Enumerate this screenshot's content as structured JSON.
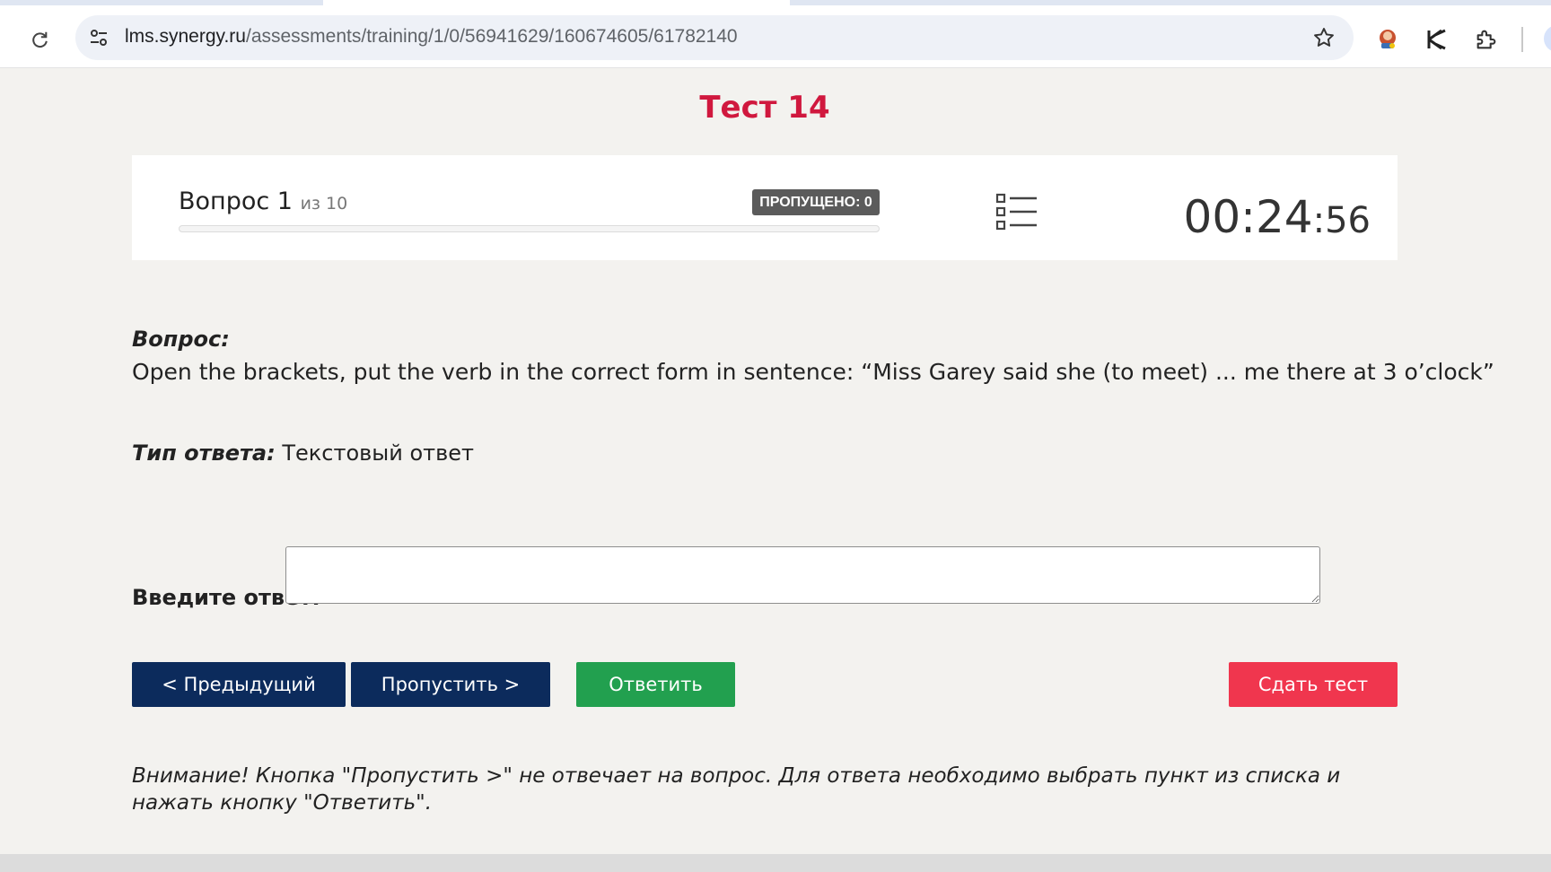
{
  "browser": {
    "url_host": "lms.synergy.ru",
    "url_path": "/assessments/training/1/0/56941629/160674605/61782140",
    "icons": [
      "reload-icon",
      "site-info-icon",
      "bookmark-star-icon",
      "extension-avatar-icon",
      "extension-k-icon",
      "extensions-puzzle-icon"
    ]
  },
  "page": {
    "title": "Тест 14"
  },
  "progress_panel": {
    "question_word": "Вопрос 1",
    "question_of": "из 10",
    "skipped_badge": "ПРОПУЩЕНО: 0",
    "progress_fraction": 0.0,
    "timer_main": "00:24",
    "timer_sec": ":56"
  },
  "question": {
    "heading": "Вопрос:",
    "text": "Open the brackets, put the verb in the correct form in sentence: “Miss Garey said she (to meet) ... me there at 3 o’clock”",
    "type_label": "Тип ответа:",
    "type_value": "Текстовый ответ"
  },
  "answer": {
    "label": "Введите ответ:",
    "value": ""
  },
  "buttons": {
    "prev": "< Предыдущий",
    "skip": "Пропустить >",
    "answer": "Ответить",
    "submit": "Сдать тест"
  },
  "notice": "Внимание! Кнопка \"Пропустить >\" не отвечает на вопрос. Для ответа необходимо выбрать пункт из списка и нажать кнопку \"Ответить\".",
  "colors": {
    "title": "#d0183e",
    "nav_button": "#0c2b5c",
    "answer_button": "#22a04f",
    "submit_button": "#f0364e",
    "badge": "#5b5b5b"
  }
}
